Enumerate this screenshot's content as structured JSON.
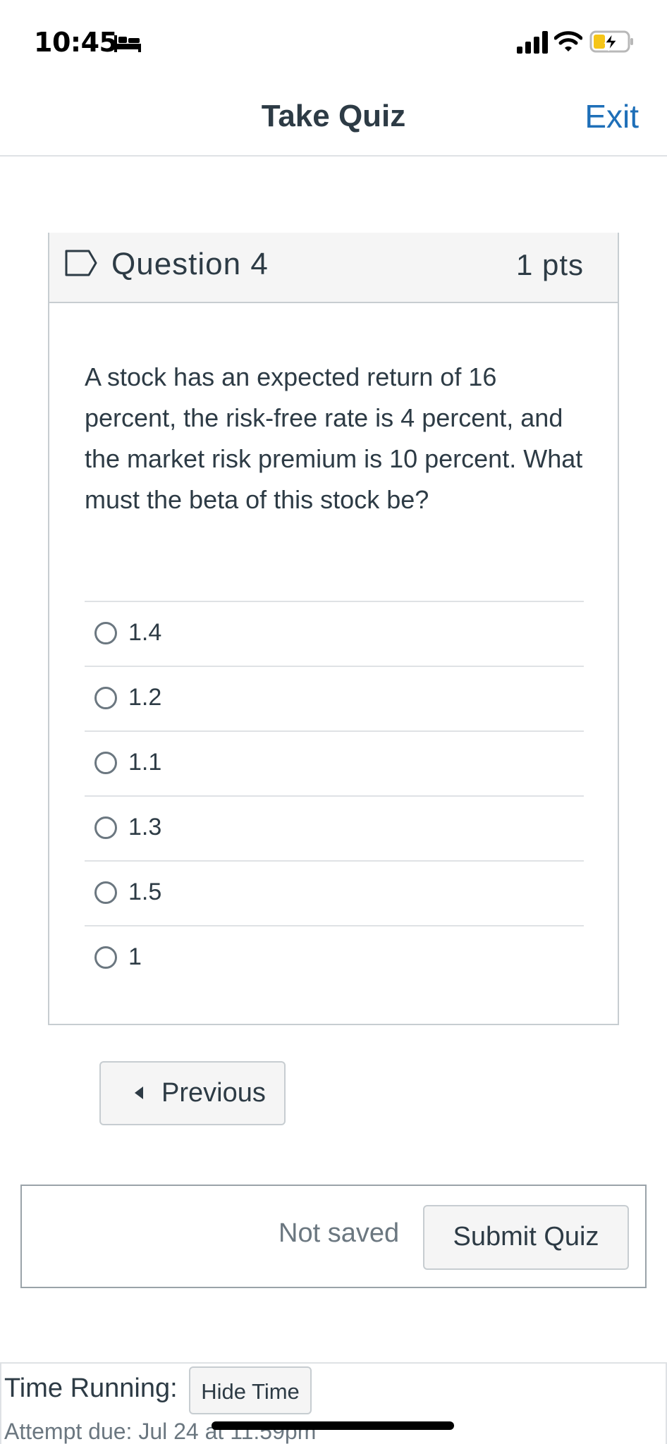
{
  "status_bar": {
    "time": "10:45",
    "icons": [
      "bed-icon",
      "signal-icon",
      "wifi-icon",
      "battery-charging-icon"
    ],
    "battery_color": "#f5c518"
  },
  "header": {
    "title": "Take Quiz",
    "exit_label": "Exit",
    "accent_color": "#1e6fb8"
  },
  "question": {
    "title": "Question 4",
    "points": "1 pts",
    "flag_icon": "flag-outline-icon",
    "text": "A stock has an expected return of 16 percent, the risk-free rate is 4 percent, and the market risk premium is 10 percent. What must the beta of this stock be?",
    "answers": [
      {
        "label": "1.4",
        "selected": false
      },
      {
        "label": "1.2",
        "selected": false
      },
      {
        "label": "1.1",
        "selected": false
      },
      {
        "label": "1.3",
        "selected": false
      },
      {
        "label": "1.5",
        "selected": false
      },
      {
        "label": "1",
        "selected": false
      }
    ]
  },
  "navigation": {
    "previous_label": "Previous"
  },
  "submit_bar": {
    "save_status": "Not saved",
    "submit_label": "Submit Quiz"
  },
  "timer": {
    "label": "Time Running:",
    "hide_label": "Hide Time",
    "attempt_due": "Attempt due: Jul 24 at 11:59pm"
  }
}
